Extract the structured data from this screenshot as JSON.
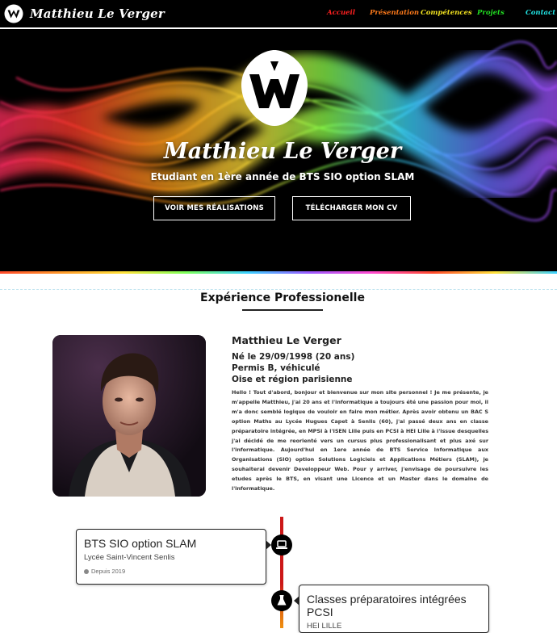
{
  "brand": {
    "name": "Matthieu Le Verger",
    "logo_icon": "w-logo-icon"
  },
  "nav": [
    {
      "label": "Accueil",
      "color": "#ff2020"
    },
    {
      "label": "Présentation",
      "color": "#ff7a1a"
    },
    {
      "label": "Compétences",
      "color": "#f0e020"
    },
    {
      "label": "Projets",
      "color": "#22dd22"
    },
    {
      "label": "Contact",
      "color": "#20e0e0"
    }
  ],
  "hero": {
    "name": "Matthieu Le Verger",
    "subtitle": "Etudiant en 1ère année de BTS SIO option SLAM",
    "buttons": [
      {
        "label": "VOIR MES RÉALISATIONS"
      },
      {
        "label": "TÉLÉCHARGER MON CV"
      }
    ]
  },
  "section": {
    "title": "Expérience Professionelle",
    "profile": {
      "name": "Matthieu Le Verger",
      "birth": "Né le 29/09/1998 (20 ans)",
      "license": "Permis B, véhiculé",
      "region": "Oise et région parisienne",
      "bio": "Hello ! Tout d'abord, bonjour et bienvenue sur mon site personnel ! Je me présente, je m'appelle Matthieu, j'ai 20 ans et l'informatique a toujours été une passion pour moi, il m'a donc semblé logique de vouloir en faire mon métier. Après avoir obtenu un BAC S option Maths au Lycée Hugues Capet à Senlis (60), j'ai passé deux ans en classe préparatoire intégrée, en MPSI à l'ISEN Lille puis en PCSI à HEI Lille à l'issue desquelles j'ai décidé de me reorienté vers un cursus plus professionalisant et plus axé sur l'informatique. Aujourd'hui en 1ere année de BTS Service Informatique aux Organisations (SIO) option Solutions Logiciels et Applications Métiers (SLAM), je souhaiterai devenir Developpeur Web. Pour y arriver, j'envisage de poursuivre les etudes après le BTS, en visant une Licence et un Master dans le domaine de l'informatique."
    }
  },
  "timeline": [
    {
      "title": "BTS SIO option SLAM",
      "place": "Lycée Saint-Vincent Senlis",
      "date": "Depuis 2019",
      "icon": "laptop-icon"
    },
    {
      "title": "Classes préparatoires intégrées PCSI",
      "place": "HEI LILLE",
      "icon": "flask-icon"
    }
  ]
}
